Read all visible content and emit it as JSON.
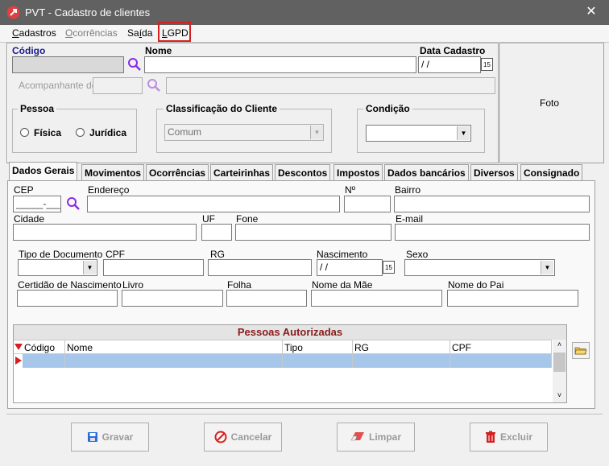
{
  "window": {
    "title": "PVT - Cadastro de clientes"
  },
  "menu": [
    {
      "label": "Cadastros",
      "access": "C",
      "rest": "adastros"
    },
    {
      "label": "Ocorrências",
      "access": "O",
      "rest": "corrências"
    },
    {
      "label": "Saída",
      "pre": "Sa",
      "access": "í",
      "rest": "da"
    },
    {
      "label": "LGPD",
      "access": "L",
      "rest": "GPD"
    }
  ],
  "header": {
    "codigo_label": "Código",
    "nome_label": "Nome",
    "data_cadastro_label": "Data Cadastro",
    "data_cadastro_value": " / /",
    "acompanhante_label": "Acompanhante de",
    "foto_label": "Foto",
    "calendar_glyph": "15"
  },
  "pessoa": {
    "label": "Pessoa",
    "fisica": "Física",
    "juridica": "Jurídica"
  },
  "classificacao": {
    "label": "Classificação do Cliente",
    "value": "Comum"
  },
  "condicao": {
    "label": "Condição",
    "value": ""
  },
  "tabs": [
    "Dados Gerais",
    "Movimentos",
    "Ocorrências",
    "Carteirinhas",
    "Descontos",
    "Impostos",
    "Dados bancários",
    "Diversos",
    "Consignado"
  ],
  "form": {
    "cep": "CEP",
    "cep_mask": "_____-___",
    "endereco": "Endereço",
    "numero": "Nº",
    "bairro": "Bairro",
    "cidade": "Cidade",
    "uf": "UF",
    "fone": "Fone",
    "email": "E-mail",
    "tipo_documento": "Tipo de Documento",
    "cpf": "CPF",
    "rg": "RG",
    "nascimento": "Nascimento",
    "nascimento_value": " / /",
    "sexo": "Sexo",
    "certidao": "Certidão de Nascimento",
    "livro": "Livro",
    "folha": "Folha",
    "nome_mae": "Nome da Mãe",
    "nome_pai": "Nome do Pai"
  },
  "autorizadas": {
    "title": "Pessoas Autorizadas",
    "columns": [
      "Código",
      "Nome",
      "Tipo",
      "RG",
      "CPF"
    ]
  },
  "buttons": {
    "gravar": "Gravar",
    "cancelar": "Cancelar",
    "limpar": "Limpar",
    "excluir": "Excluir"
  },
  "colors": {
    "titlebar": "#616161",
    "accent_red": "#d42020",
    "grid_title": "#8b1a1a",
    "selection": "#a6c6ea"
  }
}
